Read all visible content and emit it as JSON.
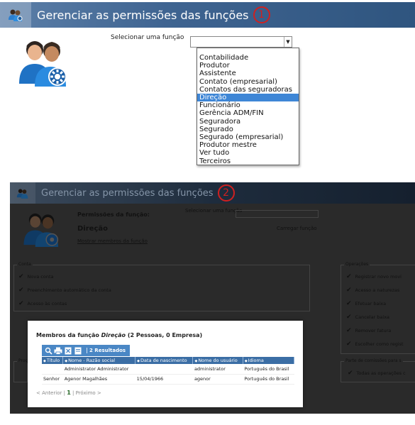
{
  "panel1": {
    "title": "Gerenciar as permissões das funções",
    "step": "1",
    "select_label": "Selecionar uma função",
    "select_value": "",
    "options": [
      "Contabilidade",
      "Produtor",
      "Assistente",
      "Contato (empresarial)",
      "Contatos das seguradoras",
      "Direção",
      "Funcionário",
      "Gerência ADM/FIN",
      "Seguradora",
      "Segurado",
      "Segurado (empresarial)",
      "Produtor mestre",
      "Ver tudo",
      "Terceiros"
    ],
    "selected_index": 5
  },
  "panel2": {
    "title": "Gerenciar as permissões das funções",
    "step": "2",
    "perm_label": "Permissões da função:",
    "role_name": "Direção",
    "select_label": "Selecionar uma função",
    "load_label": "Carregar função",
    "show_members": "Mostrar membros da função",
    "left_legend": "Conta",
    "left_checks": [
      "Nova conta",
      "Preenchimento automático da conta",
      "Acesso às contas"
    ],
    "right_legend": "Operações",
    "right_checks": [
      "Registrar novo movi",
      "Acesso a naturezas",
      "Efetuar baixa",
      "Cancelar baixa",
      "Remover fatura",
      "Escolher como regist"
    ],
    "left_bottom_legend": "Proc",
    "right_bottom_legend": "Parte de comissões para s",
    "right_bottom_check": "Todas as operações c",
    "modal": {
      "title_prefix": "Membros da função ",
      "title_role": "Direção",
      "title_suffix": " (2 Pessoas, 0 Empresa)",
      "result_count": "2 Resultados",
      "columns": [
        "Título",
        "Nome - Razão social",
        "Data de nascimento",
        "Nome do usuário",
        "Idioma"
      ],
      "rows": [
        [
          "",
          "Administrator Administrator",
          "",
          "administrator",
          "Português do Brasil"
        ],
        [
          "Senhor",
          "Agenor Magalhães",
          "15/04/1966",
          "agenor",
          "Português do Brasil"
        ]
      ],
      "pager_prev": "< Anterior",
      "pager_sep": "|",
      "pager_current": "1",
      "pager_next": "Próximo >"
    }
  },
  "colors": {
    "title_blue": "#3f6491",
    "selected_blue": "#3e86d6",
    "step_red": "#d02020",
    "toolbar_blue": "#4a87c5",
    "header_blue": "#3b6ea5"
  },
  "icons": [
    "users-group-icon",
    "gear-icon",
    "dropdown-arrow-icon",
    "checkbox-checked-icon",
    "search-icon",
    "print-icon",
    "excel-icon",
    "pdf-icon"
  ]
}
